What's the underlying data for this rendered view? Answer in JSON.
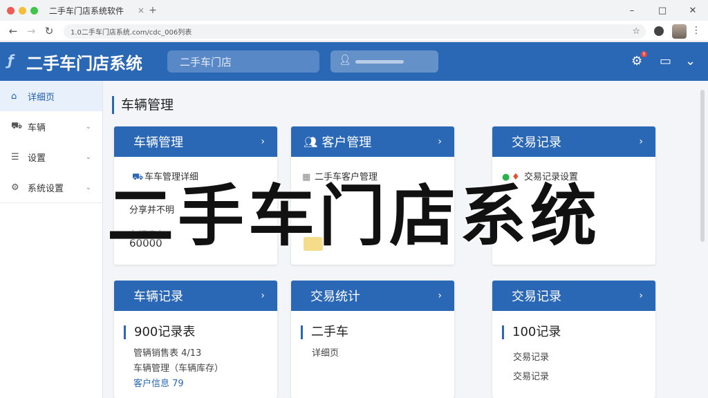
{
  "browser": {
    "tab_title": "二手车门店系统软件",
    "tab_close": "×",
    "tab_new": "+",
    "url": "1.0二手车门店系统.com/cdc_006列表",
    "win_min": "–",
    "win_max": "□",
    "win_close": "✕"
  },
  "header": {
    "title": "二手车门店系统",
    "tab_label": "二手车门店",
    "notification_count": "5"
  },
  "sidebar": {
    "items": [
      {
        "label": "详细页",
        "icon": "home-icon"
      },
      {
        "label": "车辆",
        "icon": "car-icon"
      },
      {
        "label": "设置",
        "icon": "document-icon"
      },
      {
        "label": "系统设置",
        "icon": "settings-icon"
      }
    ]
  },
  "main": {
    "breadcrumb": "车辆管理",
    "cards": [
      {
        "title": "车辆管理",
        "rows": [
          "车车管理详细",
          "分享并不明",
          "车辆库存",
          "60000"
        ]
      },
      {
        "title": "客户管理",
        "rows": [
          "二手车客户管理"
        ]
      },
      {
        "title": "交易记录",
        "rows": [
          "交易记录设置"
        ]
      },
      {
        "title": "车辆记录",
        "stat": "900记录表",
        "subs": [
          "管辆销售表 4/13",
          "车辆管理（车辆库存）",
          "客户信息 79"
        ]
      },
      {
        "title": "交易统计",
        "stat": "二手车",
        "subs": [
          "详细页"
        ]
      },
      {
        "title": "交易记录",
        "stat": "100记录",
        "subs": [
          "交易记录",
          "交易记录"
        ]
      }
    ]
  },
  "overlay": {
    "title": "二手车门店系统"
  },
  "colors": {
    "brand": "#2a67b5",
    "sidebar_active": "#e8f0fb"
  }
}
